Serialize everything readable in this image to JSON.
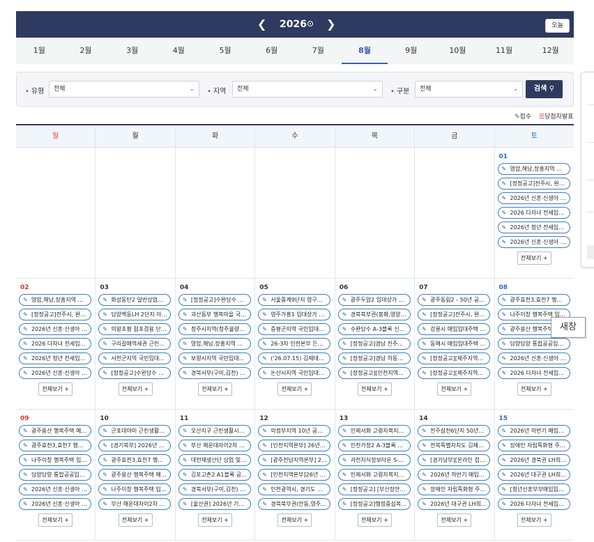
{
  "header": {
    "year": "2026",
    "prev_icon": "chevron-left-icon",
    "next_icon": "chevron-right-icon",
    "today_label": "오늘"
  },
  "months": [
    "1월",
    "2월",
    "3월",
    "4월",
    "5월",
    "6월",
    "7월",
    "8월",
    "9월",
    "10월",
    "11월",
    "12월"
  ],
  "active_month": "8월",
  "filters": {
    "type_label": "유형",
    "type_value": "전체",
    "region_label": "지역",
    "region_value": "전체",
    "category_label": "구분",
    "category_value": "전체",
    "search_label": "검색"
  },
  "legend": {
    "receipt_label": "접수",
    "winner_label": "당첨자발표"
  },
  "weekdays": [
    "일",
    "월",
    "화",
    "수",
    "목",
    "금",
    "토"
  ],
  "more_label": "전체보기 +",
  "tooltip": "새창",
  "colors": {
    "navy": "#2e3a5f",
    "sunday": "#e03030",
    "saturday": "#2d6bc4",
    "pill_border": "#3b7dc0"
  },
  "weeks": [
    [
      {
        "day": "",
        "events": []
      },
      {
        "day": "",
        "events": []
      },
      {
        "day": "",
        "events": []
      },
      {
        "day": "",
        "events": []
      },
      {
        "day": "",
        "events": []
      },
      {
        "day": "",
        "events": []
      },
      {
        "day": "01",
        "events": [
          "영암,해남,장흥지역 국...",
          "[정정공고]전주시, 완주...",
          "2026년 신혼·신생아 전...",
          "2026 다자녀 전세임대 ...",
          "2026년 청년 전세임대 ...",
          "2026년 신혼·신생아 전..."
        ]
      }
    ],
    [
      {
        "day": "02",
        "events": [
          "영암,해남,장흥지역 국...",
          "[정정공고]전주시, 완주...",
          "2026년 신혼·신생아 전...",
          "2026 다자녀 전세임대 ...",
          "2026년 청년 전세임대 ...",
          "2026년 신혼·신생아 전..."
        ]
      },
      {
        "day": "03",
        "events": [
          "화성동탄2 일반상업용...",
          "담양백동LH 2단지 아파...",
          "의왕초평 점포겸용 단독...",
          "구리갈매역세권 근린생...",
          "서천군지역 국민임대주...",
          "[정정공고]수완당수 A5..."
        ]
      },
      {
        "day": "04",
        "events": [
          "[정정공고]수완당수 A5...",
          "괴산동부 행복마을 국민...",
          "청주시지역(청주율량2, ...",
          "영암,해남,장흥지역 국...",
          "보령시지역 국민임대주...",
          "경북서부(구미,김천) 다..."
        ]
      },
      {
        "day": "05",
        "events": [
          "서울중계9단지 영구임...",
          "영주가흥1 임대상가 입...",
          "증평군지역 국민임대주...",
          "26-3차 인천본부 든든...",
          "('26.07.15) 김제대검산...",
          "논산시지역 국민임대주..."
        ]
      },
      {
        "day": "06",
        "events": [
          "광주두암2 임대상가 입...",
          "경북북부권(봉화,영양,...",
          "수완당수 A-3블록 신혼...",
          "[정정공고]경남 진주혁...",
          "[정정공고]경남 하동읍...",
          "[정정공고][인천지역본..."
        ]
      },
      {
        "day": "07",
        "events": [
          "광주동림2 - 50년 공공...",
          "[정정공고]전주시, 완주...",
          "강릉시 매입임대주택 예...",
          "동해시 매입임대주택 예...",
          "[정정공고][제주지역본...",
          "[정정공고][제주지역본..."
        ]
      },
      {
        "day": "08",
        "events": [
          "광주효천3,효천7 행복...",
          "나주이창 행복주택 입주...",
          "광주용산 행복주택 예비...",
          "담양담양 통합공공임대...",
          "2026년 신혼·신생아 전...",
          "2026 다자녀 전세임대 ..."
        ]
      }
    ],
    [
      {
        "day": "09",
        "events": [
          "광주용산 행복주택 예비...",
          "광주효천3,효천7 행복...",
          "나주이창 행복주택 입주...",
          "담양담양 통합공공임대...",
          "2026년 신혼·신생아 전...",
          "2026년 신혼·신생아 전..."
        ]
      },
      {
        "day": "10",
        "events": [
          "군포대야미 근린생활시...",
          "[경기북부] 2026년 2...",
          "광주효천3,효천7 행복...",
          "광주용산 행복주택 예비...",
          "나주이창 행복주택 입주...",
          "부산 해운대자이2차 10..."
        ]
      },
      {
        "day": "11",
        "events": [
          "오산지구 근린생활시설...",
          "부산 해운대자이2차 10...",
          "대전재생산단 상업 및 ...",
          "김포고촌2 A1블록 공공...",
          "경북서부(구미,김천) 다...",
          "[울산권] 2026년 기존..."
        ]
      },
      {
        "day": "12",
        "events": [
          "의정부지역 10년 공공...",
          "[인천지역본부] 26년 5...",
          "[광주전남지역본부] 20...",
          "[인천지역본부]26년 5...",
          "인천광역시, 경기도 부...",
          "경북북부권(안동,영주) ..."
        ]
      },
      {
        "day": "13",
        "events": [
          "인제서화 고령자복지주...",
          "인천가정2 A-3블록 단지...",
          "과천지식정보타운 S-11...",
          "인제서화 고령자복지주...",
          "[정정공고] [부산장안]...",
          "[정정공고]행정중심복..."
        ]
      },
      {
        "day": "14",
        "events": [
          "전주삼천6단지 50년공...",
          "전북특별자치도 김제시...",
          "[경기남부][온라인 접수...",
          "2026년 하반기 매입임...",
          "장애인 자립특화형 주택...",
          "2026년 대구권 LH희..."
        ]
      },
      {
        "day": "15",
        "events": [
          "2026년 하반기 매입임...",
          "장애인 자립특화형 주택...",
          "2026년 경북권 LH희...",
          "2026년 대구권 LH희...",
          "[청년신혼부부매입임대...",
          "2026 다자녀 전세임대 ..."
        ]
      }
    ]
  ]
}
